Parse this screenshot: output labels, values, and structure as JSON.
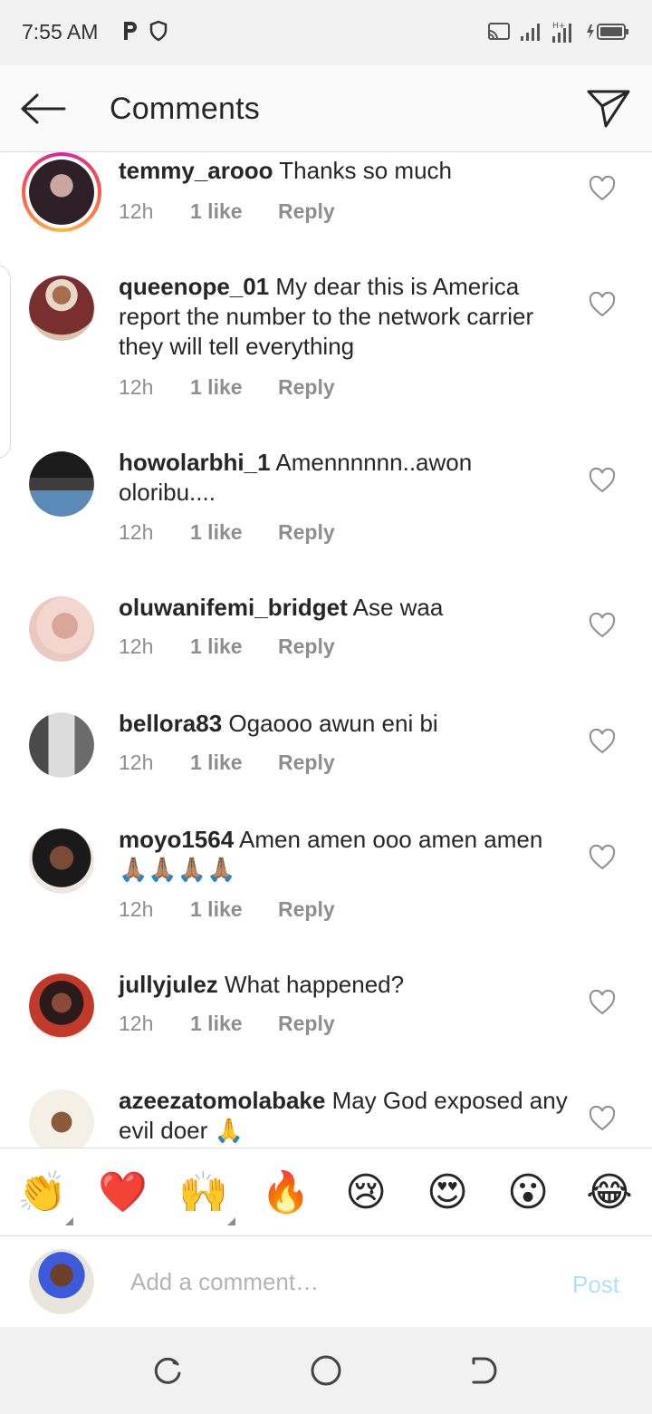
{
  "status_bar": {
    "time": "7:55 AM",
    "left_icons": [
      "p-icon",
      "shield-icon"
    ],
    "right_icons": [
      "cast-icon",
      "signal-icon",
      "signal-2-icon",
      "battery-icon"
    ]
  },
  "header": {
    "title": "Comments",
    "back_icon": "arrow-left-icon",
    "share_icon": "paper-plane-icon"
  },
  "comments": [
    {
      "username": "temmy_arooo",
      "text": "Thanks so much",
      "time": "12h",
      "likes": "1 like",
      "reply": "Reply",
      "story_ring": true
    },
    {
      "username": "queenope_01",
      "text": "My dear this is America report the number to the network carrier they will tell everything",
      "time": "12h",
      "likes": "1 like",
      "reply": "Reply"
    },
    {
      "username": "howolarbhi_1",
      "text": "Amennnnnn..awon oloribu....",
      "time": "12h",
      "likes": "1 like",
      "reply": "Reply"
    },
    {
      "username": "oluwanifemi_bridget",
      "text": "Ase waa",
      "time": "12h",
      "likes": "1 like",
      "reply": "Reply"
    },
    {
      "username": "bellora83",
      "text": "Ogaooo awun eni bi",
      "time": "12h",
      "likes": "1 like",
      "reply": "Reply"
    },
    {
      "username": "moyo1564",
      "text": "Amen amen ooo amen amen 🙏🏽🙏🏽🙏🏽🙏🏽",
      "time": "12h",
      "likes": "1 like",
      "reply": "Reply"
    },
    {
      "username": "jullyjulez",
      "text": "What happened?",
      "time": "12h",
      "likes": "1 like",
      "reply": "Reply"
    },
    {
      "username": "azeezatomolabake",
      "text": "May God exposed any evil doer 🙏",
      "time": "",
      "likes": "",
      "reply": ""
    }
  ],
  "emoji_bar": [
    "👏",
    "❤️",
    "🙌",
    "🔥",
    "😢",
    "😍",
    "😮",
    "😂"
  ],
  "compose": {
    "placeholder": "Add a comment…",
    "post_label": "Post"
  },
  "colors": {
    "text": "#262626",
    "meta": "#8e8e8e",
    "post_disabled": "#b2dffc",
    "divider": "#dbdbdb"
  }
}
